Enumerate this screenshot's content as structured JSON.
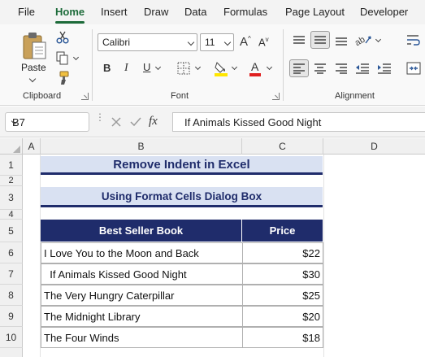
{
  "menu": {
    "tabs": [
      {
        "label": "File"
      },
      {
        "label": "Home",
        "active": true
      },
      {
        "label": "Insert"
      },
      {
        "label": "Draw"
      },
      {
        "label": "Data"
      },
      {
        "label": "Formulas"
      },
      {
        "label": "Page Layout"
      },
      {
        "label": "Developer"
      }
    ]
  },
  "ribbon": {
    "clipboard": {
      "label": "Clipboard",
      "paste_label": "Paste"
    },
    "font": {
      "label": "Font",
      "font_name": "Calibri",
      "font_size": "11"
    },
    "alignment": {
      "label": "Alignment"
    },
    "colors": {
      "highlight": "#ffe600",
      "font_color": "#e02020"
    }
  },
  "formula_bar": {
    "name_box": "B7",
    "fx_label": "fx",
    "formula": "If Animals Kissed Good Night"
  },
  "grid": {
    "columns": [
      "A",
      "B",
      "C",
      "D"
    ],
    "rows": [
      "1",
      "2",
      "3",
      "4",
      "5",
      "6",
      "7",
      "8",
      "9",
      "10"
    ]
  },
  "sheet": {
    "title": "Remove Indent in Excel",
    "subtitle": "Using Format Cells Dialog Box",
    "headers": {
      "book": "Best Seller Book",
      "price": "Price"
    },
    "rows": [
      {
        "book": "I Love You to the Moon and Back",
        "price": "$22"
      },
      {
        "book": "  If Animals Kissed Good Night",
        "price": "$30"
      },
      {
        "book": "The Very Hungry Caterpillar",
        "price": "$25"
      },
      {
        "book": "The Midnight Library",
        "price": "$20"
      },
      {
        "book": "The Four Winds",
        "price": "$18"
      }
    ],
    "accent": "#1f2c6b",
    "title_fill": "#d9e1f2"
  }
}
